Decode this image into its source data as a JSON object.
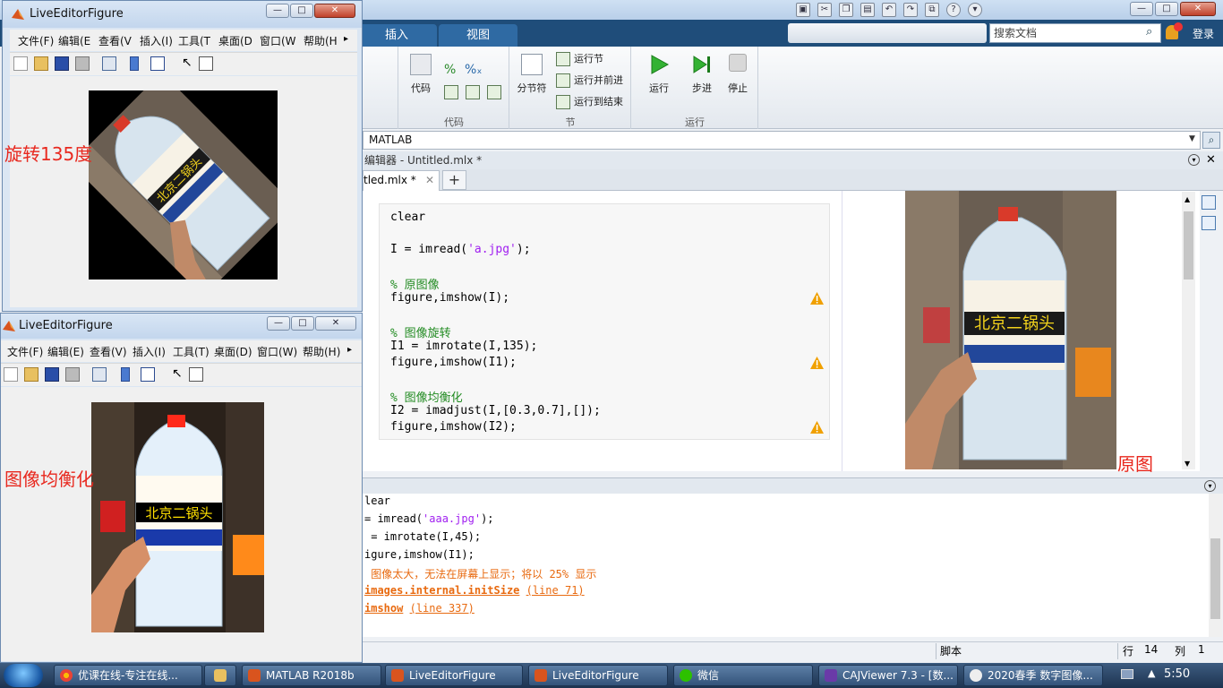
{
  "matlab": {
    "tabs": [
      "插入",
      "视图"
    ],
    "search_placeholder": "搜索文档",
    "login": "登录",
    "ribbon": {
      "code_section": "代码",
      "code_btn": "代码",
      "section_section": "节",
      "section_break": "分节符",
      "run_section": "运行节",
      "run_and_advance": "运行并前进",
      "run_to_end": "运行到结束",
      "run_group": "运行",
      "run": "运行",
      "step": "步进",
      "stop": "停止"
    },
    "address": "MATLAB",
    "editor_title": "编辑器 - Untitled.mlx *",
    "doc_tab": "tled.mlx *",
    "code": {
      "l1": "clear",
      "l2a": "I = imread(",
      "l2s": "'a.jpg'",
      "l2b": ");",
      "c1": "% 原图像",
      "l3": "figure,imshow(I);",
      "c2": "% 图像旋转",
      "l4": "I1 = imrotate(I,135);",
      "l5": "figure,imshow(I1);",
      "c3": "% 图像均衡化",
      "l6": "I2 = imadjust(I,[0.3,0.7],[]);",
      "l7": "figure,imshow(I2);"
    },
    "output_label": "原图",
    "command": {
      "l1": "lear",
      "l2a": "= imread(",
      "l2s": "'aaa.jpg'",
      "l2b": ");",
      "l3": " = imrotate(I,45);",
      "l4": "igure,imshow(I1);",
      "w1": " 图像太大，无法在屏幕上显示；将以 25% 显示",
      "w2link": "images.internal.initSize",
      "w2line": "(line 71)",
      "w3link": "imshow",
      "w3line": "(line 337)"
    },
    "status": {
      "script": "脚本",
      "row_label": "行",
      "row": "14",
      "col_label": "列",
      "col": "1"
    }
  },
  "figure1": {
    "title": "LiveEditorFigure",
    "menu": [
      "文件(F)",
      "编辑(E",
      "查看(V",
      "插入(I)",
      "工具(T",
      "桌面(D",
      "窗口(W",
      "帮助(H"
    ],
    "label": "旋转135度"
  },
  "figure2": {
    "title": "LiveEditorFigure",
    "menu": [
      "文件(F)",
      "编辑(E)",
      "查看(V)",
      "插入(I)",
      "工具(T)",
      "桌面(D)",
      "窗口(W)",
      "帮助(H)"
    ],
    "label": "图像均衡化"
  },
  "taskbar": {
    "items": [
      "优课在线-专注在线...",
      "",
      "MATLAB R2018b",
      "LiveEditorFigure",
      "LiveEditorFigure",
      "微信",
      "CAJViewer 7.3 - [数...",
      "2020春季 数字图像..."
    ],
    "clock": "5:50"
  },
  "icons": {
    "warning": "warning-icon",
    "run": "run-icon",
    "step": "step-icon",
    "stop": "stop-icon",
    "search": "search-icon"
  },
  "colors": {
    "comment": "#228b22",
    "string": "#a020f0",
    "error": "#e86a10",
    "label_red": "#e8281e",
    "taskbar": "#1d3350"
  }
}
